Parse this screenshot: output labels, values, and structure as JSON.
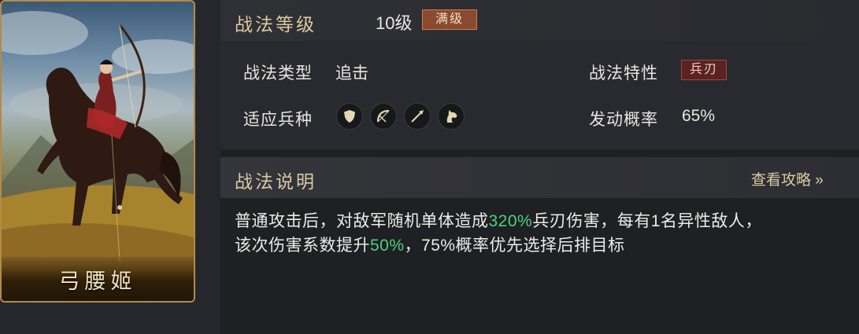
{
  "card": {
    "name": "弓腰姬"
  },
  "level": {
    "title": "战法等级",
    "value": "10级",
    "badge": "满级"
  },
  "attributes": {
    "type_label": "战法类型",
    "type_value": "追击",
    "trait_label": "战法特性",
    "trait_value": "兵刃",
    "troops_label": "适应兵种",
    "troops": [
      "shield-icon",
      "bow-icon",
      "spear-icon",
      "horse-icon"
    ],
    "chance_label": "发动概率",
    "chance_value": "65%"
  },
  "description": {
    "title": "战法说明",
    "guide_link": "查看攻略 »",
    "line1_a": "普通攻击后，对敌军随机单体造成",
    "line1_hl": "320%",
    "line1_b": "兵刃伤害，每有1名异性敌人，",
    "line2_a": "该次伤害系数提升",
    "line2_hl": "50%",
    "line2_b": "，75%概率优先选择后排目标"
  },
  "colors": {
    "highlight": "#4fd07a",
    "gold": "#dcc9a3",
    "max_badge": "#8a4a2e",
    "blade_badge": "#5a2222"
  }
}
